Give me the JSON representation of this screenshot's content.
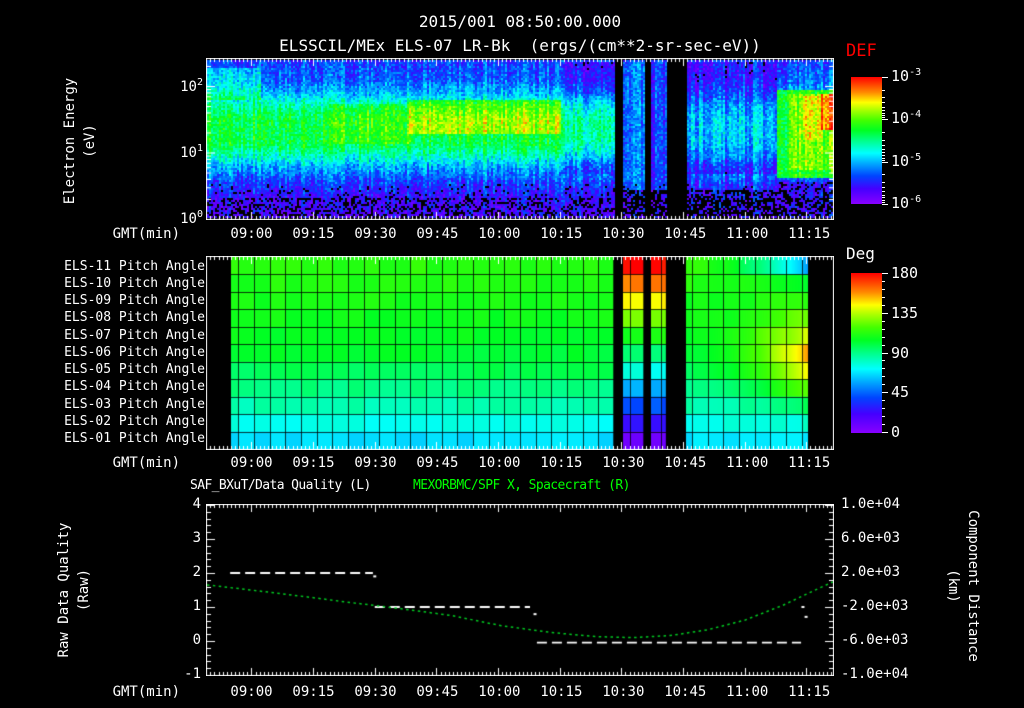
{
  "colors": {
    "background": "#000000",
    "foreground": "#ffffff",
    "def_label": "#ff0000",
    "right_title": "#00ff00",
    "quality_series": "#ffffff",
    "spacecraft_curve": "#00cc22",
    "colormap_stops": [
      [
        0,
        "#8800ff"
      ],
      [
        0.12,
        "#4400ff"
      ],
      [
        0.22,
        "#0044ff"
      ],
      [
        0.32,
        "#00aaff"
      ],
      [
        0.4,
        "#00ffff"
      ],
      [
        0.5,
        "#00ff88"
      ],
      [
        0.58,
        "#00ff22"
      ],
      [
        0.66,
        "#44ff00"
      ],
      [
        0.74,
        "#aaff00"
      ],
      [
        0.8,
        "#ffff00"
      ],
      [
        0.88,
        "#ff8800"
      ],
      [
        1,
        "#ff0000"
      ]
    ]
  },
  "title": {
    "datetime": "2015/001 08:50:00.000",
    "source": "ELSSCIL/MEx ELS-07 LR-Bk  (ergs/(cm**2-sr-sec-eV))"
  },
  "time_axis": {
    "label": "GMT(min)",
    "ticks": [
      "09:00",
      "09:15",
      "09:30",
      "09:45",
      "10:00",
      "10:15",
      "10:30",
      "10:45",
      "11:00",
      "11:15"
    ]
  },
  "spectrogram_panel": {
    "y_label_line1": "Electron Energy",
    "y_label_line2": "(eV)",
    "y_ticks": [
      {
        "base": "10",
        "exp": "2"
      },
      {
        "base": "10",
        "exp": "1"
      },
      {
        "base": "10",
        "exp": "0"
      }
    ],
    "colorbar": {
      "title": "DEF",
      "ticks": [
        {
          "base": "10",
          "exp": "-3"
        },
        {
          "base": "10",
          "exp": "-4"
        },
        {
          "base": "10",
          "exp": "-5"
        },
        {
          "base": "10",
          "exp": "-6"
        }
      ]
    }
  },
  "pitch_panel": {
    "row_labels": [
      "ELS-11 Pitch Angle",
      "ELS-10 Pitch Angle",
      "ELS-09 Pitch Angle",
      "ELS-08 Pitch Angle",
      "ELS-07 Pitch Angle",
      "ELS-06 Pitch Angle",
      "ELS-05 Pitch Angle",
      "ELS-04 Pitch Angle",
      "ELS-03 Pitch Angle",
      "ELS-02 Pitch Angle",
      "ELS-01 Pitch Angle"
    ],
    "colorbar": {
      "title": "Deg",
      "ticks": [
        "180",
        "135",
        "90",
        "45",
        "0"
      ]
    }
  },
  "bottom_panel": {
    "left_title": "SAF_BXuT/Data Quality (L)",
    "right_title": "MEXORBMC/SPF X, Spacecraft (R)",
    "left_label_line1": "Raw Data Quality",
    "left_label_line2": "(Raw)",
    "right_label_line1": "Component Distance",
    "right_label_line2": "(km)",
    "left_ticks": [
      "4",
      "3",
      "2",
      "1",
      "0",
      "-1"
    ],
    "right_ticks": [
      "1.0e+04",
      "6.0e+03",
      "2.0e+03",
      "-2.0e+03",
      "-6.0e+03",
      "-1.0e+04"
    ]
  },
  "chart_data": [
    {
      "type": "heatmap",
      "name": "electron-energy-spectrogram",
      "title": "ELSSCIL/MEx ELS-07 LR-Bk",
      "units": "ergs/(cm**2-sr-sec-eV)",
      "x_label": "GMT(min)",
      "x_ticks": [
        "09:00",
        "09:15",
        "09:30",
        "09:45",
        "10:00",
        "10:15",
        "10:30",
        "10:45",
        "11:00",
        "11:15"
      ],
      "x_range_minutes_rel_0900": [
        -10.8,
        141.4
      ],
      "y_label": "Electron Energy (eV)",
      "y_scale": "log",
      "y_range_ev": [
        1,
        245
      ],
      "flux_range": [
        1e-06,
        0.001
      ],
      "flux_profile_by_log10_ev": [
        [
          0,
          0.1
        ],
        [
          0.3,
          0.13
        ],
        [
          0.55,
          0.2
        ],
        [
          0.8,
          0.33
        ],
        [
          1.0,
          0.48
        ],
        [
          1.15,
          0.56
        ],
        [
          1.5,
          0.57
        ],
        [
          1.7,
          0.5
        ],
        [
          1.9,
          0.34
        ],
        [
          2.1,
          0.25
        ],
        [
          2.39,
          0.21
        ]
      ],
      "features": [
        {
          "f": [
            0,
            0.085
          ],
          "le": [
            1.8,
            2.3
          ],
          "add": 0.13
        },
        {
          "f": [
            0.2,
            0.33
          ],
          "le": [
            1.15,
            1.75
          ],
          "add": 0.07
        },
        {
          "f": [
            0.32,
            0.565
          ],
          "le": [
            1.3,
            1.8
          ],
          "add": 0.17
        },
        {
          "f": [
            0.565,
            0.649
          ],
          "le": [
            0.7,
            2.39
          ],
          "add": -0.09
        },
        {
          "f": [
            0.649,
            0.6645
          ],
          "black": true
        },
        {
          "f": [
            0.6645,
            0.697
          ],
          "le": [
            0.45,
            2.39
          ],
          "set": 0.25
        },
        {
          "f": [
            0.6645,
            0.697
          ],
          "le": [
            0,
            0.45
          ],
          "set": 0.12,
          "dropout": 0.5
        },
        {
          "f": [
            0.697,
            0.708
          ],
          "black": true
        },
        {
          "f": [
            0.708,
            0.733
          ],
          "le": [
            0.45,
            2.39
          ],
          "set": 0.19
        },
        {
          "f": [
            0.708,
            0.733
          ],
          "le": [
            0,
            0.45
          ],
          "set": 0.1,
          "dropout": 0.5
        },
        {
          "f": [
            0.733,
            0.764
          ],
          "black": true
        },
        {
          "f": [
            0.764,
            0.908
          ],
          "le": [
            0.7,
            2.39
          ],
          "scale": 0.62
        },
        {
          "f": [
            0.764,
            0.908
          ],
          "le": [
            0,
            0.45
          ],
          "dropout": 0.4
        },
        {
          "f": [
            0.908,
            0.999
          ],
          "le": [
            0.62,
            1.95
          ],
          "set": 0.6
        },
        {
          "f": [
            0.93,
            0.999
          ],
          "le": [
            0.75,
            1.9
          ],
          "add": 0.08
        },
        {
          "f": [
            0.95,
            0.978
          ],
          "le": [
            1.2,
            1.85
          ],
          "set": 0.78
        },
        {
          "f": [
            0.978,
            0.999
          ],
          "le": [
            1.35,
            1.9
          ],
          "set": 0.9
        },
        {
          "f": [
            0.908,
            0.999
          ],
          "le": [
            0,
            0.57
          ],
          "set": 0.13,
          "dropout": 0.25
        },
        {
          "f": [
            0,
            1
          ],
          "le": [
            0,
            0.32
          ],
          "dropout": 0.3
        },
        {
          "f": [
            0,
            1
          ],
          "le": [
            0.3,
            0.55
          ],
          "dropout": 0.07
        }
      ],
      "data_gaps_frac": [
        [
          0.649,
          0.6645
        ],
        [
          0.697,
          0.708
        ],
        [
          0.733,
          0.764
        ]
      ]
    },
    {
      "type": "heatmap",
      "name": "pitch-angle-panels",
      "deg_range": [
        0,
        180
      ],
      "rows_base_deg": [
        113,
        111,
        109,
        107,
        105,
        102,
        97,
        91,
        84,
        75,
        67
      ],
      "no_data_frac": [
        [
          0,
          0.0368
        ],
        [
          0.9601,
          1
        ]
      ],
      "gaps_frac": [
        [
          0.649,
          0.6645
        ],
        [
          0.697,
          0.708
        ],
        [
          0.733,
          0.764
        ]
      ],
      "rainbow_cols_frac": [
        [
          0.6645,
          0.697
        ],
        [
          0.708,
          0.733
        ]
      ],
      "rainbow_top_deg": 178,
      "rainbow_step_deg": 17,
      "warm_region": {
        "f": [
          0.78,
          0.9601
        ],
        "row_add_deg": [
          -58,
          -10,
          4,
          18,
          35,
          52,
          45,
          30,
          12,
          4,
          0
        ]
      }
    },
    {
      "type": "line",
      "name": "quality-and-spacecraft-x",
      "left_axis": {
        "label": "Raw Data Quality (Raw)",
        "range": [
          -1,
          4
        ]
      },
      "right_axis": {
        "label": "Component Distance (km)",
        "range": [
          -10000,
          10000
        ]
      },
      "series": [
        {
          "name": "SAF_BXuT/Data Quality",
          "axis": "left",
          "style": "dashed",
          "color": "#ffffff",
          "segments": [
            {
              "f": [
                0.037,
                0.265
              ],
              "value": 2
            },
            {
              "f": [
                0.268,
                0.516
              ],
              "value": 1
            },
            {
              "f": [
                0.527,
                0.949
              ],
              "value": -0.05
            }
          ],
          "points": [
            {
              "f": 0.268,
              "value": 1.9
            },
            {
              "f": 0.524,
              "value": 0.79
            },
            {
              "f": 0.952,
              "value": 1.0
            },
            {
              "f": 0.957,
              "value": 0.71
            }
          ]
        },
        {
          "name": "MEXORBMC/SPF X",
          "axis": "right",
          "style": "dotted",
          "color": "#00cc22",
          "f": [
            0,
            0.07,
            0.15,
            0.23,
            0.31,
            0.39,
            0.47,
            0.55,
            0.62,
            0.68,
            0.74,
            0.8,
            0.86,
            0.92,
            0.96,
            1
          ],
          "value_left_units": [
            1.65,
            1.5,
            1.32,
            1.13,
            0.95,
            0.75,
            0.45,
            0.25,
            0.13,
            0.1,
            0.16,
            0.33,
            0.62,
            1.05,
            1.4,
            1.74
          ],
          "value_km": [
            600,
            0,
            -720,
            -1480,
            -2200,
            -3000,
            -4200,
            -5000,
            -5480,
            -5600,
            -5360,
            -4680,
            -3520,
            -1800,
            -400,
            960
          ]
        }
      ]
    }
  ]
}
